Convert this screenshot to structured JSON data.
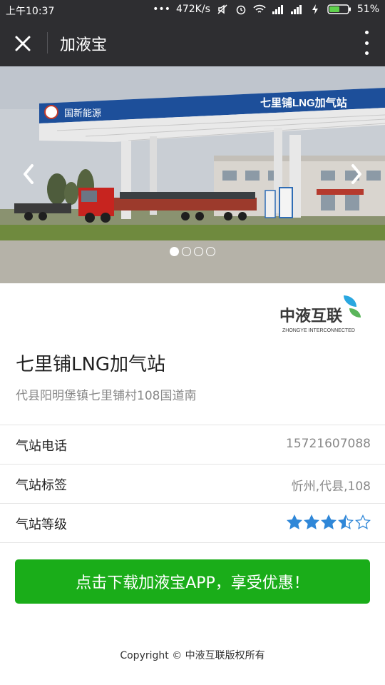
{
  "statusbar": {
    "time": "上午10:37",
    "dots": "•••",
    "speed": "472K/s",
    "battery": "51%"
  },
  "navbar": {
    "title": "加液宝"
  },
  "banner": {
    "canopy_brand": "国新能源",
    "canopy_station": "七里铺LNG加气站",
    "slides_total": 4,
    "slide_active": 1
  },
  "logo": {
    "name": "中液互联",
    "subtitle": "ZHONGYE INTERCONNECTED"
  },
  "station": {
    "name": "七里铺LNG加气站",
    "address": "代县阳明堡镇七里铺村108国道南"
  },
  "details": {
    "phone_label": "气站电话",
    "phone_value": "15721607088",
    "tags_label": "气站标签",
    "tags_value": "忻州,代县,108",
    "rating_label": "气站等级",
    "rating_value": 3.5,
    "rating_max": 5
  },
  "cta": {
    "label": "点击下载加液宝APP，享受优惠！"
  },
  "footer": {
    "copyright": "Copyright © 中液互联版权所有"
  },
  "colors": {
    "status_bg": "#2e2e31",
    "cta_green": "#1aad19",
    "star_blue": "#2f87d8"
  }
}
